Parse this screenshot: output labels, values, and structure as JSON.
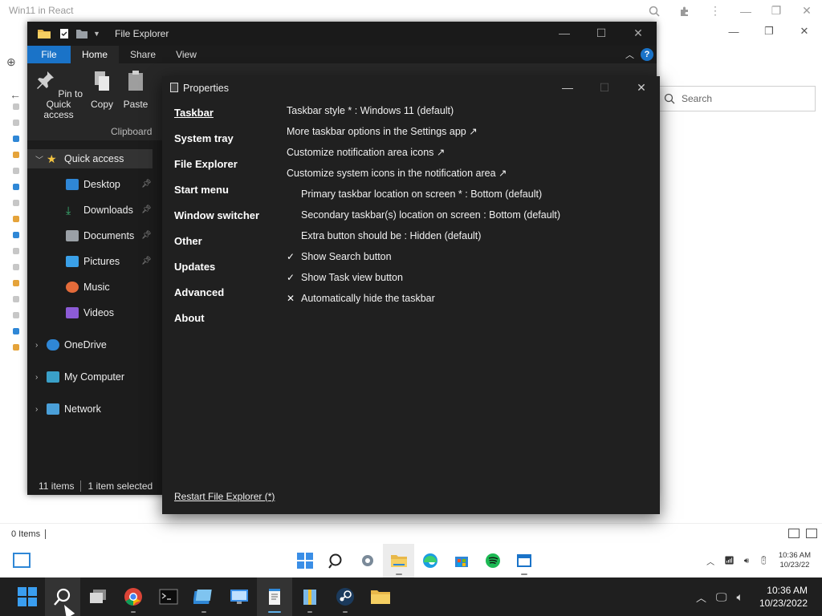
{
  "browser": {
    "title": "Win11 in React"
  },
  "background_explorer": {
    "search_placeholder": "Search",
    "status_items": "0 Items"
  },
  "file_explorer": {
    "title": "File Explorer",
    "tabs": {
      "file": "File",
      "home": "Home",
      "share": "Share",
      "view": "View"
    },
    "ribbon": {
      "pin_label_1": "Pin to Quick",
      "pin_label_2": "access",
      "copy_label": "Copy",
      "paste_label": "Paste",
      "group_label": "Clipboard"
    },
    "nav": [
      {
        "label": "Quick access"
      },
      {
        "label": "Desktop"
      },
      {
        "label": "Downloads"
      },
      {
        "label": "Documents"
      },
      {
        "label": "Pictures"
      },
      {
        "label": "Music"
      },
      {
        "label": "Videos"
      },
      {
        "label": "OneDrive"
      },
      {
        "label": "My Computer"
      },
      {
        "label": "Network"
      }
    ],
    "status": {
      "count": "11 items",
      "selected": "1 item selected"
    }
  },
  "properties": {
    "title": "Properties",
    "nav": [
      "Taskbar",
      "System tray",
      "File Explorer",
      "Start menu",
      "Window switcher",
      "Other",
      "Updates",
      "Advanced",
      "About"
    ],
    "rows": [
      "Taskbar style * : Windows 11 (default)",
      "More taskbar options in the Settings app ↗",
      "Customize notification area icons ↗",
      "Customize system icons in the notification area ↗",
      "Primary taskbar location on screen * : Bottom (default)",
      "Secondary taskbar(s) location on screen : Bottom (default)",
      "Extra button should be : Hidden (default)",
      "Show Search button",
      "Show Task view button",
      "Automatically hide the taskbar"
    ],
    "marks": {
      "check1": "✓",
      "check2": "✓",
      "cross": "✕"
    },
    "footer": "Restart File Explorer (*)"
  },
  "inner_taskbar": {
    "time": "10:36 AM",
    "date": "10/23/22"
  },
  "outer_taskbar": {
    "time": "10:36 AM",
    "date": "10/23/2022"
  },
  "colors": {
    "accent": "#1a73c8",
    "dialog_bg": "#202020",
    "taskbar_bg": "#1f1f1f"
  }
}
